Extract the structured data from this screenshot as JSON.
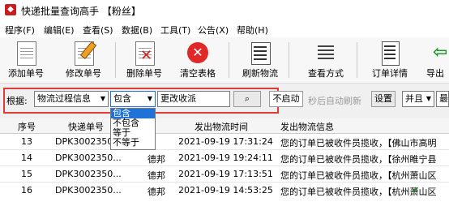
{
  "window": {
    "title": "快递批量查询高手 【粉丝】",
    "icon": "app-icon"
  },
  "menu": [
    "程序(F)",
    "编辑(E)",
    "查看(S)",
    "数据(B)",
    "工具(T)",
    "公告(X)",
    "帮助(H)"
  ],
  "toolbar": {
    "add": "添加单号",
    "edit": "修改单号",
    "delete": "删除单号",
    "clear": "清空表格",
    "refresh": "刷新物流",
    "view": "查看方式",
    "detail": "订单详情",
    "export": "导出"
  },
  "filter": {
    "label": "根据:",
    "field_select": "物流过程信息",
    "op_select": "包含",
    "keyword": "更改收派",
    "status_btn": "不启动",
    "auto_refresh_label": "秒后自动刷新",
    "settings_btn": "设置",
    "combine_select": "并且",
    "more_select": "最",
    "op_options": [
      "包含",
      "不包含",
      "等于",
      "不等于"
    ],
    "icons": {
      "search": "search-icon"
    }
  },
  "table": {
    "headers": [
      "序号",
      "快递单号",
      "",
      "发出物流时间",
      "发出物流信息"
    ],
    "rows": [
      [
        "13",
        "DPK3002350...",
        "",
        "2021-09-19 17:31:24",
        "您的订单已被收件员揽收，【佛山市高明"
      ],
      [
        "14",
        "DPK3002350...",
        "德邦",
        "2021-09-19 19:24:11",
        "您的订单已被收件员揽收，【徐州睢宁县"
      ],
      [
        "15",
        "DPK3002350...",
        "德邦",
        "2021-09-19 17:13:51",
        "您的订单已被收件员揽收，【杭州萧山区"
      ],
      [
        "16",
        "DPK3002350...",
        "德邦",
        "2021-09-19 14:53:25",
        "您的订单已被收件员揽收，【杭州萧山区"
      ]
    ]
  }
}
